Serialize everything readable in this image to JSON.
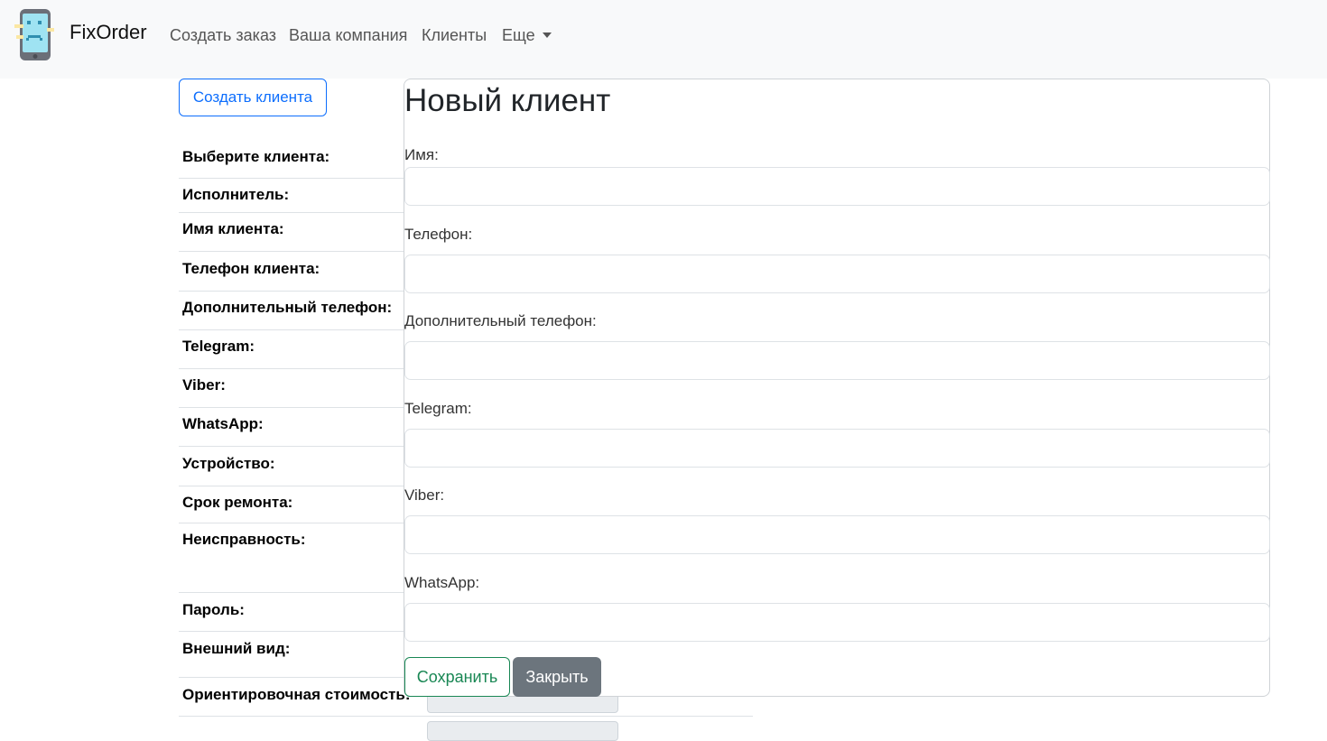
{
  "navbar": {
    "brand": "FixOrder",
    "links": [
      "Создать заказ",
      "Ваша компания",
      "Клиенты",
      "Еще"
    ]
  },
  "left": {
    "create_client_button": "Создать клиента",
    "rows": [
      "Выберите клиента:",
      "Исполнитель:",
      "Имя клиента:",
      "Телефон клиента:",
      "Дополнительный телефон:",
      "Telegram:",
      "Viber:",
      "WhatsApp:",
      "Устройство:",
      "Срок ремонта:",
      "Неисправность:",
      "Пароль:",
      "Внешний вид:",
      "Ориентировочная стоимость:"
    ]
  },
  "modal": {
    "title": "Новый клиент",
    "fields": [
      {
        "label": "Имя:",
        "value": ""
      },
      {
        "label": "Телефон:",
        "value": ""
      },
      {
        "label": "Дополнительный телефон:",
        "value": ""
      },
      {
        "label": "Telegram:",
        "value": ""
      },
      {
        "label": "Viber:",
        "value": ""
      },
      {
        "label": "WhatsApp:",
        "value": ""
      }
    ],
    "save_label": "Сохранить",
    "close_label": "Закрыть"
  },
  "colors": {
    "primary": "#0d6efd",
    "success": "#198754",
    "secondary": "#6c757d",
    "navbar_bg": "#f8f9fa"
  }
}
